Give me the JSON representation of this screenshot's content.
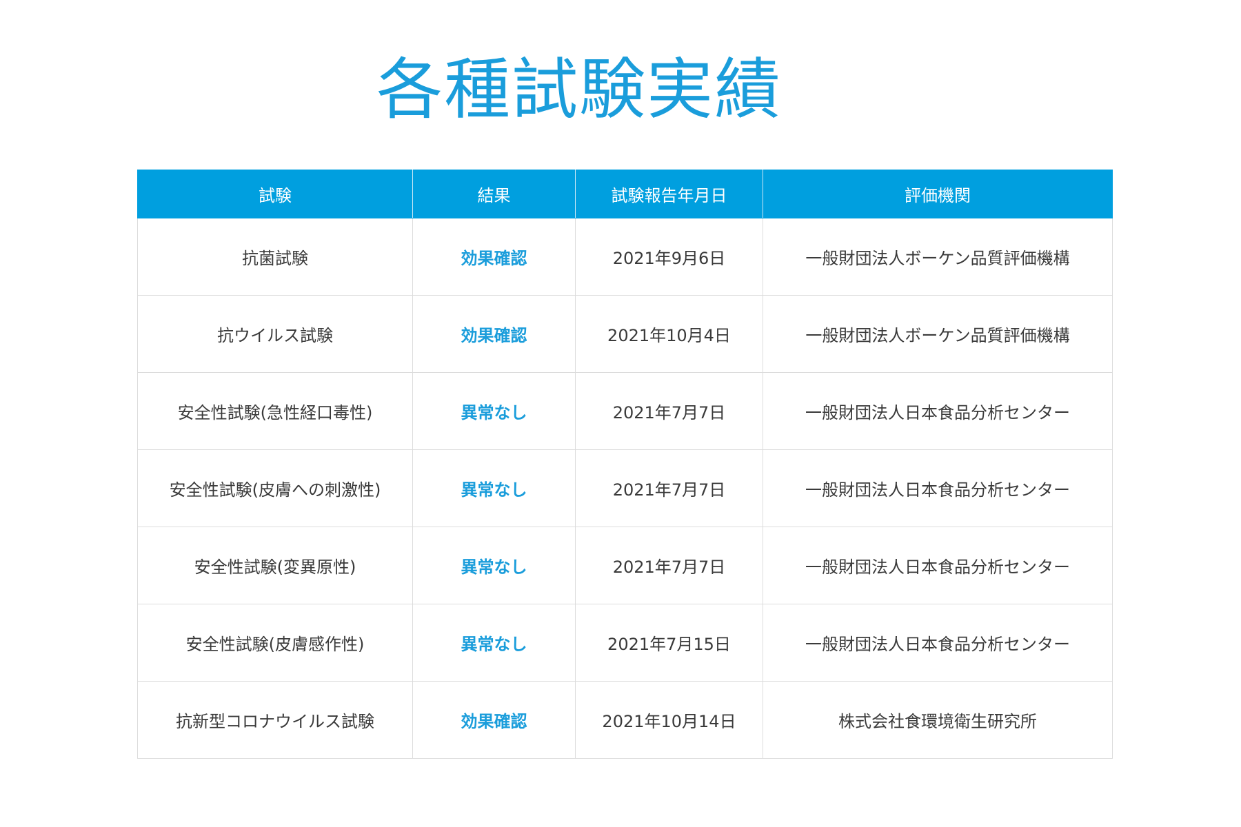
{
  "title": "各種試験実績",
  "table": {
    "headers": [
      "試験",
      "結果",
      "試験報告年月日",
      "評価機関"
    ],
    "rows": [
      {
        "test": "抗菌試験",
        "result": "効果確認",
        "date": "2021年9月6日",
        "org": "一般財団法人ボーケン品質評価機構"
      },
      {
        "test": "抗ウイルス試験",
        "result": "効果確認",
        "date": "2021年10月4日",
        "org": "一般財団法人ボーケン品質評価機構"
      },
      {
        "test": "安全性試験(急性経口毒性)",
        "result": "異常なし",
        "date": "2021年7月7日",
        "org": "一般財団法人日本食品分析センター"
      },
      {
        "test": "安全性試験(皮膚への刺激性)",
        "result": "異常なし",
        "date": "2021年7月7日",
        "org": "一般財団法人日本食品分析センター"
      },
      {
        "test": "安全性試験(変異原性)",
        "result": "異常なし",
        "date": "2021年7月7日",
        "org": "一般財団法人日本食品分析センター"
      },
      {
        "test": "安全性試験(皮膚感作性)",
        "result": "異常なし",
        "date": "2021年7月15日",
        "org": "一般財団法人日本食品分析センター"
      },
      {
        "test": "抗新型コロナウイルス試験",
        "result": "効果確認",
        "date": "2021年10月14日",
        "org": "株式会社食環境衛生研究所"
      }
    ]
  },
  "colors": {
    "accent": "#009fdf",
    "title_text": "#1a9ddb",
    "body_text": "#3a3a3a",
    "grid": "#dcdcdc"
  }
}
